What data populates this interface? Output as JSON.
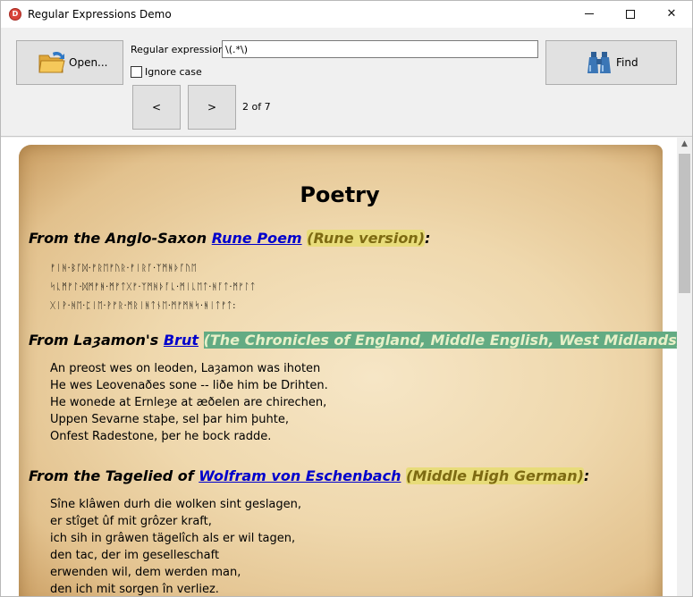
{
  "window": {
    "title": "Regular Expressions Demo"
  },
  "toolbar": {
    "open_label": "Open...",
    "find_label": "Find",
    "regex_label": "Regular expression:",
    "regex_value": "\\(.*\\)",
    "ignore_case_label": "Ignore case",
    "ignore_case_checked": false,
    "prev_label": "<",
    "next_label": ">",
    "match_counter": "2 of 7"
  },
  "document": {
    "title": "Poetry",
    "sections": [
      {
        "prefix": "From the Anglo-Saxon ",
        "link": "Rune Poem",
        "highlight": "(Rune version)",
        "suffix": ":",
        "lines": [
          "ᚠᛁᚻ·ᛒᚪᛞ·ᚠᚱᛖᚠᚢᚱ·ᚠᛁᚱᚪ·ᛉᛗᚻᚦᚪᚢᛖ",
          "ᛋᚳᛗᚠᛚ·ᛞᛗᚠᚻ·ᛗᚠᛏᚷᚠ·ᛉᛗᚻᚦᚪᚳ·ᛗᛁᚳᛖᛏ·ᚻᚪᛏ·ᛗᚠᛚᛏ",
          "ᚷᛁᚹ·ᚻᛖ·ᛈᛁᛖ·ᚹᚠᚱ·ᛗᚱᛁᚻᛏᚾᛖ·ᛗᚠᛗᚻᛋ·ᚻᛁᛏᚠᛏ:"
        ]
      },
      {
        "prefix": "From Laȝamon's ",
        "link": "Brut",
        "highlight": "(The Chronicles of England, Middle English, West Midlands)",
        "suffix": ":",
        "lines": [
          "An preost wes on leoden, Laȝamon was ihoten",
          "He wes Leovenaðes sone -- liðe him be Drihten.",
          "He wonede at Ernleȝe at æðelen are chirechen,",
          "Uppen Sevarne staþe, sel þar him þuhte,",
          "Onfest Radestone, þer he bock radde."
        ]
      },
      {
        "prefix": "From the Tagelied of ",
        "link": "Wolfram von Eschenbach",
        "highlight": "(Middle High German)",
        "suffix": ":",
        "lines": [
          "Sîne klâwen durh die wolken sint geslagen,",
          "er stîget ûf mit grôzer kraft,",
          "ich sih in grâwen tägelîch als er wil tagen,",
          "den tac, der im geselleschaft",
          "erwenden wil, dem werden man,",
          "den ich mit sorgen în verliez."
        ]
      }
    ]
  }
}
